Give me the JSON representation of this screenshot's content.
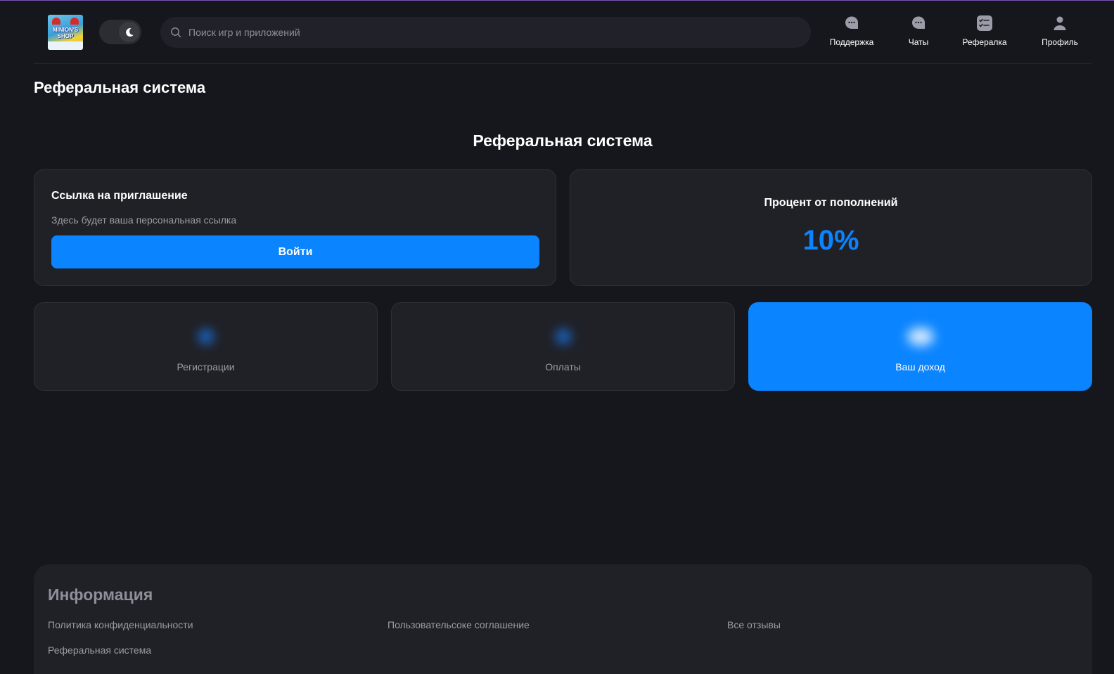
{
  "header": {
    "logo": {
      "line1": "MINION'S",
      "line2": "SHOP"
    },
    "theme_toggle": {
      "icon": "moon-icon"
    },
    "search": {
      "placeholder": "Поиск игр и приложений",
      "value": ""
    },
    "nav": [
      {
        "label": "Поддержка",
        "icon": "support-chat-icon"
      },
      {
        "label": "Чаты",
        "icon": "chat-icon"
      },
      {
        "label": "Рефералка",
        "icon": "checklist-icon"
      },
      {
        "label": "Профиль",
        "icon": "user-icon"
      }
    ]
  },
  "page": {
    "title": "Реферальная система",
    "section_title": "Реферальная система"
  },
  "invite": {
    "title": "Ссылка на приглашение",
    "description": "Здесь будет ваша персональная ссылка",
    "button": "Войти"
  },
  "percent": {
    "title": "Процент от пополнений",
    "value": "10%"
  },
  "stats": [
    {
      "label": "Регистрации"
    },
    {
      "label": "Оплаты"
    },
    {
      "label": "Ваш доход"
    }
  ],
  "footer": {
    "title": "Информация",
    "links": {
      "privacy": "Политика конфиденциальности",
      "terms": "Пользовательсоке соглашение",
      "reviews": "Все отзывы",
      "referral": "Реферальная система"
    }
  },
  "colors": {
    "background": "#16171c",
    "card": "#202127",
    "accent": "#0a84ff",
    "muted_text": "#9a9ca5"
  }
}
